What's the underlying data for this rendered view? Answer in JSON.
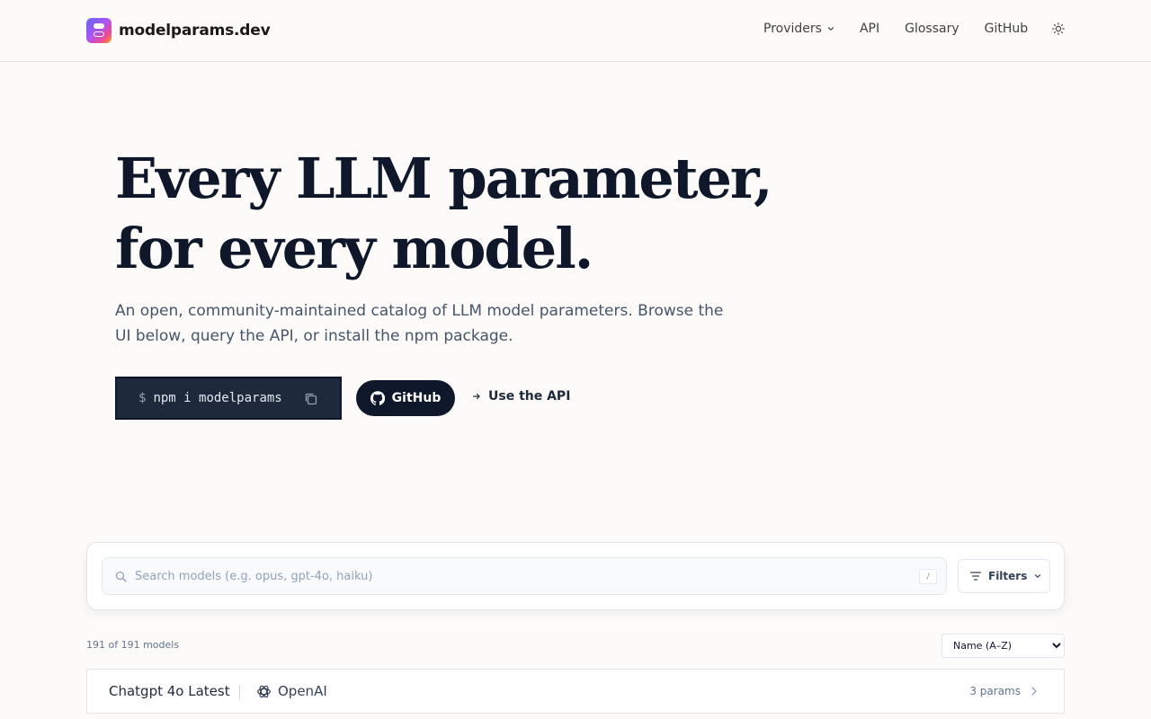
{
  "header": {
    "logo_text": "modelparams.dev",
    "nav": {
      "providers": "Providers",
      "api": "API",
      "glossary": "Glossary",
      "github": "GitHub"
    }
  },
  "hero": {
    "title_line1": "Every LLM parameter,",
    "title_line2": "for every model.",
    "subtitle": "An open, community-maintained catalog of LLM model parameters. Browse the UI below, query the API, or install the npm package.",
    "npm_prompt": "$",
    "npm_command": "npm i modelparams",
    "github_button": "GitHub",
    "api_link": "Use the API"
  },
  "search": {
    "placeholder": "Search models (e.g. opus, gpt-4o, haiku)",
    "value": "",
    "shortcut": "/",
    "filters_label": "Filters"
  },
  "results": {
    "count_text": "191 of 191 models",
    "sort_selected": "Name (A–Z)"
  },
  "models": [
    {
      "name": "Chatgpt 4o Latest",
      "provider": "OpenAI",
      "params": "3 params"
    }
  ],
  "colors": {
    "background": "#fcfbf9",
    "dark": "#0f172a",
    "muted": "#64748b"
  }
}
